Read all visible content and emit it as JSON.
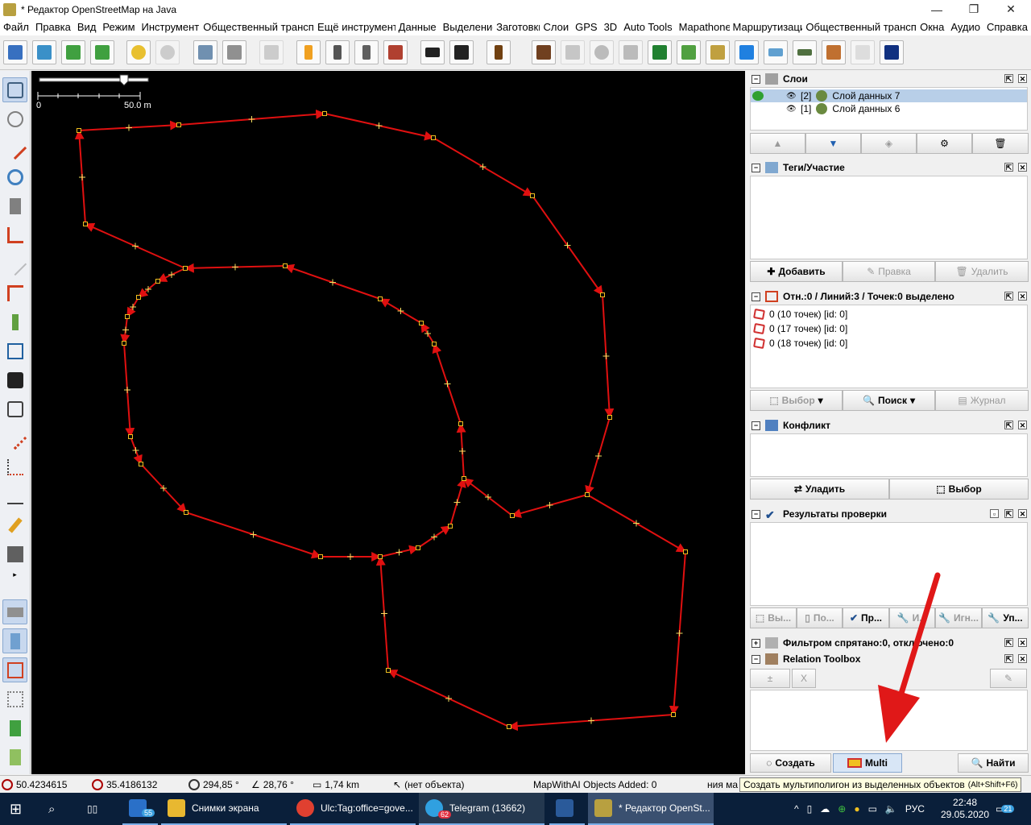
{
  "window": {
    "title": "* Редактор OpenStreetMap на Java",
    "controls": {
      "minimize": "—",
      "maximize": "❐",
      "close": "✕"
    }
  },
  "menu": [
    "Файл",
    "Правка",
    "Вид",
    "Режим",
    "Инструменты",
    "Общественный транспорт",
    "Ещё инструменты",
    "Данные",
    "Выделение",
    "Заготовки",
    "Слои",
    "GPS",
    "3D",
    "Auto Tools",
    "Mapathoner",
    "Маршрутизация",
    "Общественный транспорт",
    "Окна",
    "Аудио",
    "Справка"
  ],
  "toolbar_icons": [
    "open-icon",
    "download-icon",
    "download-data-icon",
    "upload-icon",
    "undo-icon",
    "redo-icon",
    "preferences-icon",
    "info-icon",
    "imagery-icon",
    "road-icon",
    "road-dark-icon",
    "traffic-light-icon",
    "wall-icon",
    "car-icon",
    "bus-icon",
    "restaurant-icon",
    "factory-icon",
    "building-icon",
    "gear-icon",
    "parking-icon",
    "forest-icon",
    "grass-icon",
    "farmland-icon",
    "water-icon",
    "wetland-icon",
    "landuse-icon",
    "cross-tool-icon",
    "disabled-icon",
    "blue-number-icon"
  ],
  "left_tools": [
    "select-tool-icon",
    "lasso-tool-icon",
    "draw-tool-icon",
    "zoom-tool-icon",
    "delete-tool-icon",
    "improve-way-icon",
    "parallel-tool-icon",
    "split-tool-icon",
    "tag-tool-icon",
    "relation-tool-icon",
    "bus-stop-icon",
    "transfer-icon",
    "align-icon",
    "extract-icon",
    "add-node-icon",
    "pencil-icon",
    "building-tool-icon",
    "layers-toggle-icon",
    "tags-toggle-icon",
    "selection-toggle-icon",
    "conflict-toggle-icon",
    "validator-toggle-icon",
    "filter-toggle-icon"
  ],
  "map": {
    "scale_start": "0",
    "scale_end": "50.0 m"
  },
  "layers": {
    "title": "Слои",
    "items": [
      {
        "index": "[2]",
        "name": "Слой данных 7",
        "selected": true
      },
      {
        "index": "[1]",
        "name": "Слой данных 6",
        "selected": false
      }
    ]
  },
  "tags": {
    "title": "Теги/Участие",
    "add": "Добавить",
    "edit": "Правка",
    "delete": "Удалить"
  },
  "selection": {
    "title": "Отн.:0 / Линий:3 / Точек:0 выделено",
    "items": [
      "0 (10 точек) [id: 0]",
      "0 (17 точек) [id: 0]",
      "0 (18 точек) [id: 0]"
    ],
    "select": "Выбор",
    "search": "Поиск",
    "history": "Журнал"
  },
  "conflict": {
    "title": "Конфликт",
    "resolve": "Уладить",
    "select": "Выбор"
  },
  "validation": {
    "title": "Результаты проверки",
    "buttons": [
      "Вы...",
      "По...",
      "Пр...",
      "И...",
      "Игн...",
      "Уп..."
    ]
  },
  "filter": {
    "title": "Фильтром спрятано:0, отключено:0"
  },
  "relation_toolbox": {
    "title": "Relation Toolbox",
    "create": "Создать",
    "multi": "Multi",
    "find": "Найти"
  },
  "status": {
    "lat": "50.4234615",
    "lon": "35.4186132",
    "heading": "294,85 °",
    "angle": "28,76 °",
    "distance": "1,74 km",
    "object": "(нет объекта)",
    "mapwithai": "MapWithAI Objects Added: 0",
    "truncated": "ния ма"
  },
  "tooltip": {
    "text": "Создать мультиполигон из выделенных объектов",
    "shortcut": "(Alt+Shift+F6)"
  },
  "taskbar": {
    "mail_badge": "55",
    "tasks": [
      "Снимки экрана",
      "Ulc:Tag:office=gove...",
      "Telegram (13662)",
      "* Редактор OpenSt..."
    ],
    "telegram_badge": "62",
    "lang": "РУС",
    "time": "22:48",
    "date": "29.05.2020",
    "notifications": "21"
  },
  "colors": {
    "way": "#e01010",
    "node": "#f0c020",
    "selection_bg": "#b8cfe8",
    "taskbar": "#0a1f3a"
  }
}
